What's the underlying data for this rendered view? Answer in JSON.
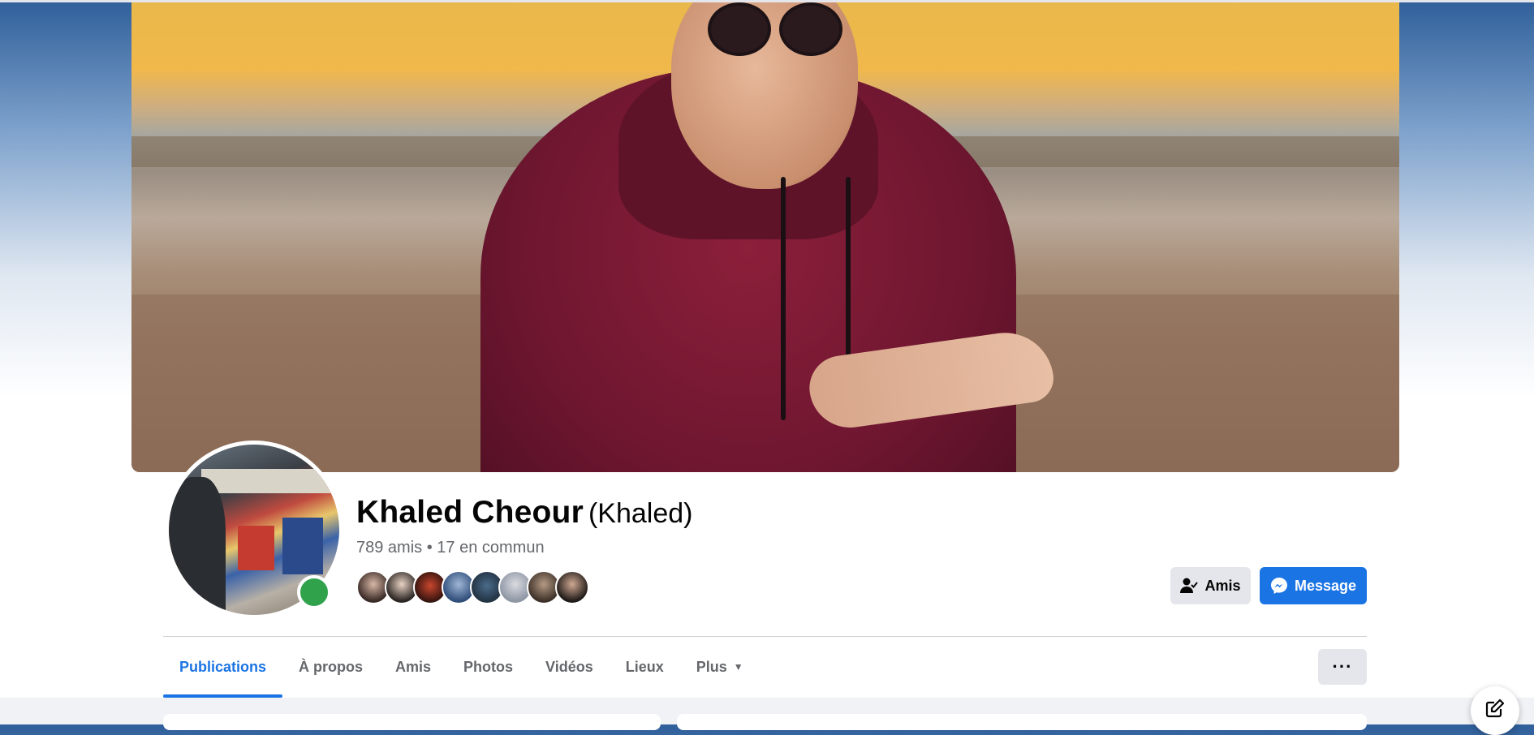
{
  "profile": {
    "name": "Khaled Cheour",
    "alternate_name": "(Khaled)",
    "friends_summary": "789 amis • 17 en commun",
    "online": true
  },
  "actions": {
    "friends_label": "Amis",
    "message_label": "Message"
  },
  "tabs": [
    {
      "label": "Publications",
      "active": true
    },
    {
      "label": "À propos",
      "active": false
    },
    {
      "label": "Amis",
      "active": false
    },
    {
      "label": "Photos",
      "active": false
    },
    {
      "label": "Vidéos",
      "active": false
    },
    {
      "label": "Lieux",
      "active": false
    },
    {
      "label": "Plus",
      "active": false
    }
  ],
  "more_button": "···",
  "colors": {
    "accent": "#1b74e4",
    "online": "#31a24c",
    "secondary_button": "#e4e6eb",
    "muted_text": "#65676b"
  },
  "icons": [
    "friend-check-icon",
    "messenger-icon",
    "caret-down-icon",
    "compose-icon"
  ]
}
